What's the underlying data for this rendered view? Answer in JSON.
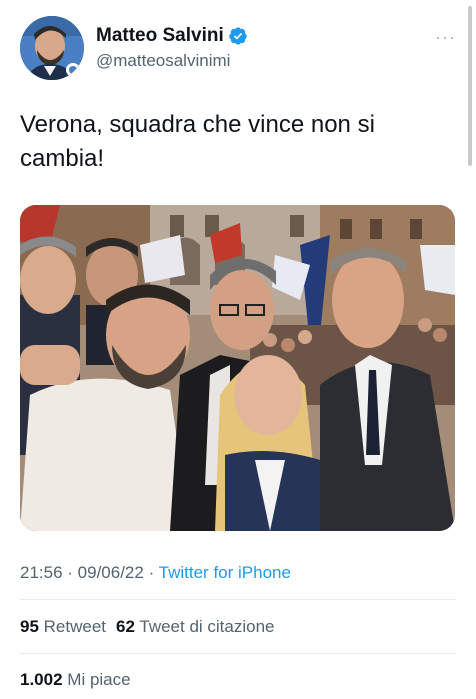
{
  "author": {
    "display_name": "Matteo Salvini",
    "handle": "@matteosalvinimi",
    "verified_icon": "verified-badge-icon"
  },
  "menu": {
    "label": "···"
  },
  "tweet": {
    "text": "Verona, squadra che vince non si cambia!"
  },
  "meta": {
    "time": "21:56",
    "separator1": " · ",
    "date": "09/06/22",
    "separator2": " · ",
    "source": "Twitter for iPhone"
  },
  "stats": {
    "retweets_count": "95",
    "retweets_label": "Retweet",
    "quotes_count": "62",
    "quotes_label": "Tweet di citazione",
    "likes_count": "1.002",
    "likes_label": "Mi piace"
  },
  "colors": {
    "link": "#1d9bf0",
    "secondary_text": "#536471",
    "verified": "#1d9bf0"
  }
}
